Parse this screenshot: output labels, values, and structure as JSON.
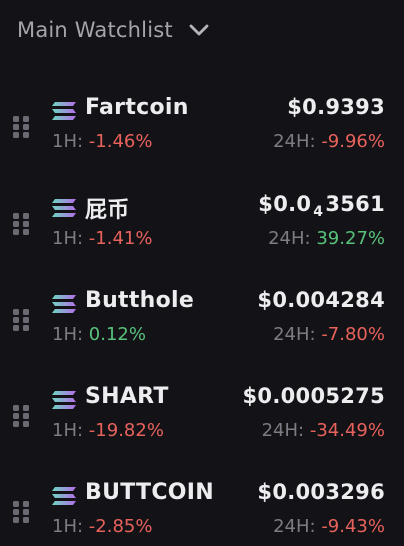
{
  "header": {
    "title": "Main Watchlist"
  },
  "coins": [
    {
      "name": "Fartcoin",
      "price": "$0.9393",
      "change_1h": "-1.46%",
      "change_1h_dir": "neg",
      "change_24h": "-9.96%",
      "change_24h_dir": "neg"
    },
    {
      "name": "屁币",
      "price_main": "$0.0",
      "price_sub": "4",
      "price_rest": "3561",
      "change_1h": "-1.41%",
      "change_1h_dir": "neg",
      "change_24h": "39.27%",
      "change_24h_dir": "pos"
    },
    {
      "name": "Butthole",
      "price": "$0.004284",
      "change_1h": "0.12%",
      "change_1h_dir": "pos",
      "change_24h": "-7.80%",
      "change_24h_dir": "neg"
    },
    {
      "name": "SHART",
      "price": "$0.0005275",
      "change_1h": "-19.82%",
      "change_1h_dir": "neg",
      "change_24h": "-34.49%",
      "change_24h_dir": "neg"
    },
    {
      "name": "BUTTCOIN",
      "price": "$0.003296",
      "change_1h": "-2.85%",
      "change_1h_dir": "neg",
      "change_24h": "-9.43%",
      "change_24h_dir": "neg"
    }
  ],
  "labels": {
    "h1": "1H:",
    "h24": "24H:"
  },
  "icons": {
    "chevron": "chevron-down-icon",
    "drag": "drag-handle-icon",
    "chain": "solana-icon"
  },
  "colors": {
    "negative": "#e8625c",
    "positive": "#58c27a",
    "background": "#131317"
  }
}
